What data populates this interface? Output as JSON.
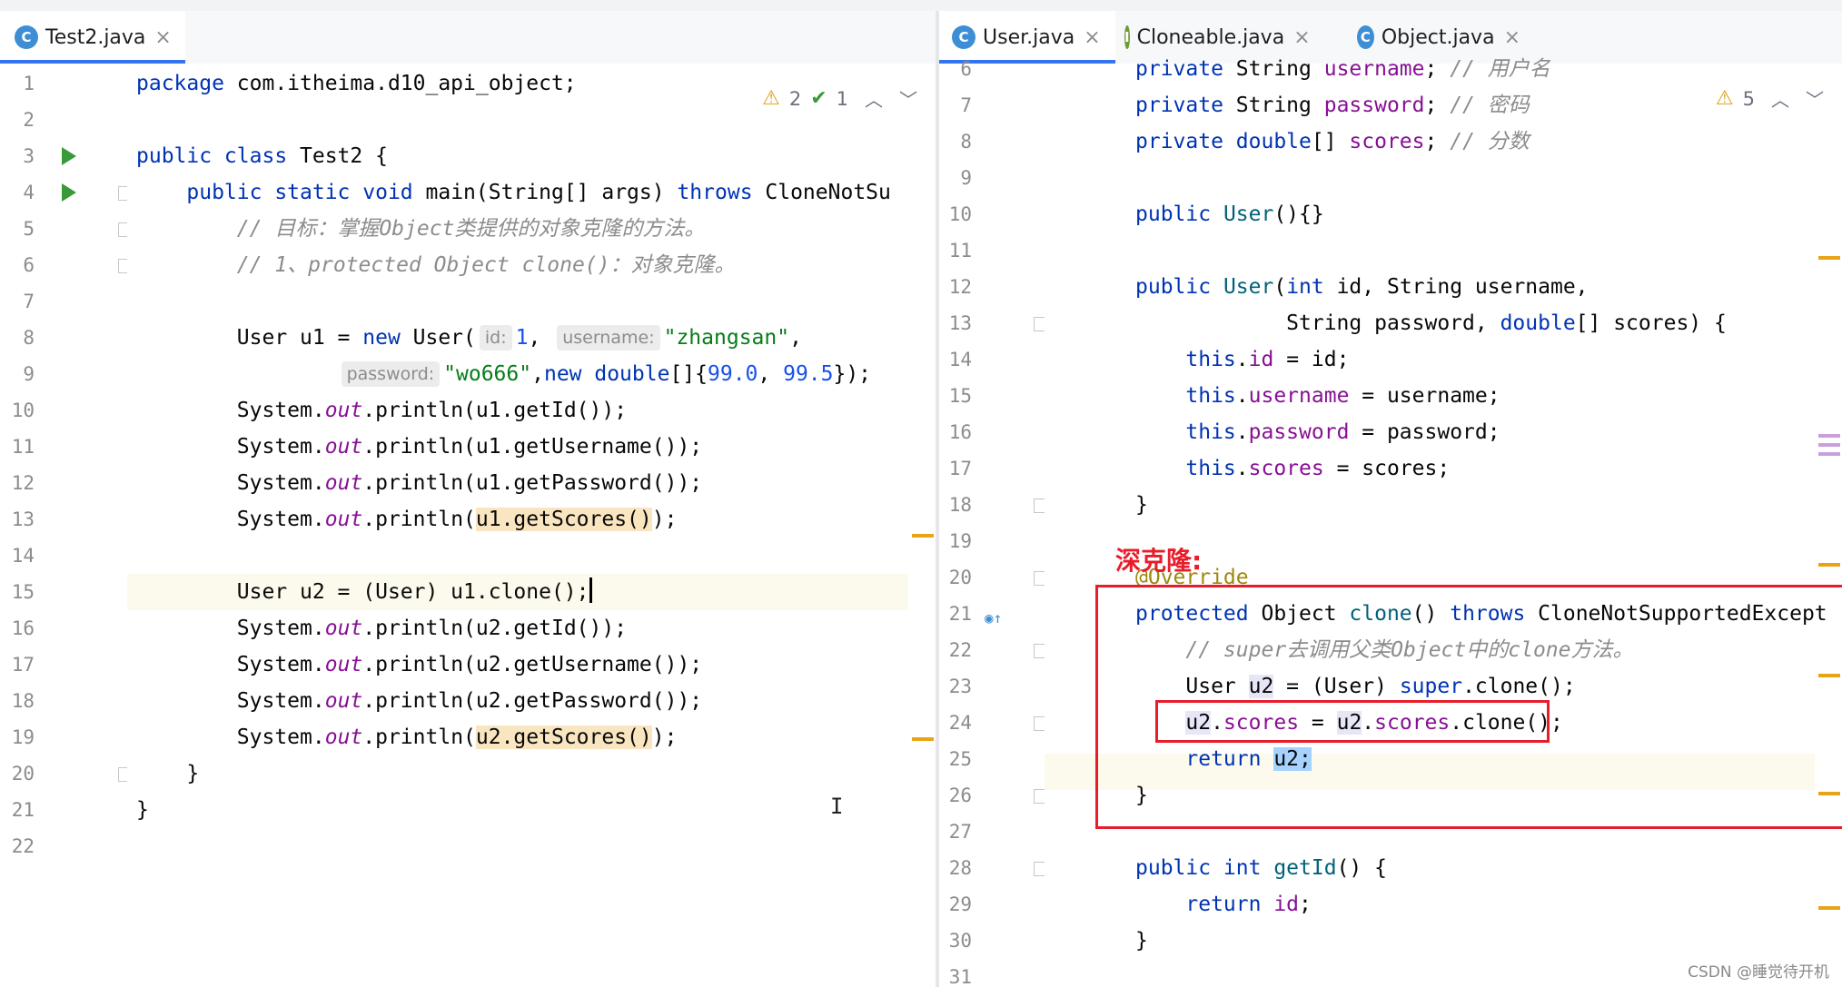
{
  "left": {
    "tabs": [
      {
        "label": "Test2.java",
        "icon": "c-class-icon"
      }
    ],
    "inspections": {
      "warnings": "2",
      "weak_warnings": "1"
    },
    "lines": [
      {
        "num": "1",
        "parts": [
          {
            "t": "package ",
            "c": "kw"
          },
          {
            "t": "com.itheima.d10_api_object;"
          }
        ]
      },
      {
        "num": "2",
        "parts": []
      },
      {
        "num": "3",
        "parts": [
          {
            "t": "public class ",
            "c": "kw"
          },
          {
            "t": "Test2 {"
          }
        ]
      },
      {
        "num": "4",
        "parts": [
          {
            "t": "    "
          },
          {
            "t": "public static void ",
            "c": "kw"
          },
          {
            "t": "main(String[] args) "
          },
          {
            "t": "throws ",
            "c": "kw"
          },
          {
            "t": "CloneNotSu"
          }
        ]
      },
      {
        "num": "5",
        "parts": [
          {
            "t": "        "
          },
          {
            "t": "// 目标：掌握Object类提供的对象克隆的方法。",
            "c": "cmt"
          }
        ]
      },
      {
        "num": "6",
        "parts": [
          {
            "t": "        "
          },
          {
            "t": "// 1、protected Object clone()：对象克隆。",
            "c": "cmt"
          }
        ]
      },
      {
        "num": "7",
        "parts": []
      },
      {
        "num": "8",
        "parts": [
          {
            "t": "        User u1 = "
          },
          {
            "t": "new ",
            "c": "kw"
          },
          {
            "t": "User("
          },
          {
            "t": "id:",
            "c": "hint"
          },
          {
            "t": "1",
            "c": "num"
          },
          {
            "t": ", "
          },
          {
            "t": "username:",
            "c": "hint"
          },
          {
            "t": "\"zhangsan\"",
            "c": "str"
          },
          {
            "t": ","
          }
        ]
      },
      {
        "num": "9",
        "parts": [
          {
            "t": "                "
          },
          {
            "t": "password:",
            "c": "hint"
          },
          {
            "t": "\"wo666\"",
            "c": "str"
          },
          {
            "t": ","
          },
          {
            "t": "new ",
            "c": "kw"
          },
          {
            "t": "double",
            "c": "kw"
          },
          {
            "t": "[]{"
          },
          {
            "t": "99.0",
            "c": "num"
          },
          {
            "t": ", "
          },
          {
            "t": "99.5",
            "c": "num"
          },
          {
            "t": "});"
          }
        ]
      },
      {
        "num": "10",
        "parts": [
          {
            "t": "        System."
          },
          {
            "t": "out",
            "c": "st"
          },
          {
            "t": ".println(u1.getId());"
          }
        ]
      },
      {
        "num": "11",
        "parts": [
          {
            "t": "        System."
          },
          {
            "t": "out",
            "c": "st"
          },
          {
            "t": ".println(u1.getUsername());"
          }
        ]
      },
      {
        "num": "12",
        "parts": [
          {
            "t": "        System."
          },
          {
            "t": "out",
            "c": "st"
          },
          {
            "t": ".println(u1.getPassword());"
          }
        ]
      },
      {
        "num": "13",
        "parts": [
          {
            "t": "        System."
          },
          {
            "t": "out",
            "c": "st"
          },
          {
            "t": ".println("
          },
          {
            "t": "u1.getScores()",
            "c": "hl"
          },
          {
            "t": ");"
          }
        ]
      },
      {
        "num": "14",
        "parts": []
      },
      {
        "num": "15",
        "parts": [
          {
            "t": "        User u2 = (User) u1.clone();"
          },
          {
            "t": "",
            "c": "caret"
          }
        ]
      },
      {
        "num": "16",
        "parts": [
          {
            "t": "        System."
          },
          {
            "t": "out",
            "c": "st"
          },
          {
            "t": ".println(u2.getId());"
          }
        ]
      },
      {
        "num": "17",
        "parts": [
          {
            "t": "        System."
          },
          {
            "t": "out",
            "c": "st"
          },
          {
            "t": ".println(u2.getUsername());"
          }
        ]
      },
      {
        "num": "18",
        "parts": [
          {
            "t": "        System."
          },
          {
            "t": "out",
            "c": "st"
          },
          {
            "t": ".println(u2.getPassword());"
          }
        ]
      },
      {
        "num": "19",
        "parts": [
          {
            "t": "        System."
          },
          {
            "t": "out",
            "c": "st"
          },
          {
            "t": ".println("
          },
          {
            "t": "u2.getScores()",
            "c": "hl"
          },
          {
            "t": ");"
          }
        ]
      },
      {
        "num": "20",
        "parts": [
          {
            "t": "    }"
          }
        ]
      },
      {
        "num": "21",
        "parts": [
          {
            "t": "}"
          }
        ]
      },
      {
        "num": "22",
        "parts": []
      }
    ]
  },
  "right": {
    "tabs": [
      {
        "label": "User.java",
        "icon": "c-class-icon"
      },
      {
        "label": "Cloneable.java",
        "icon": "i-interface-icon"
      },
      {
        "label": "Object.java",
        "icon": "c-class-icon"
      }
    ],
    "inspections": {
      "warnings": "5"
    },
    "annotation_label": "深克隆:",
    "lines": [
      {
        "num": "6",
        "parts": [
          {
            "t": "private ",
            "c": "kw"
          },
          {
            "t": "String "
          },
          {
            "t": "username",
            "c": "fld"
          },
          {
            "t": "; "
          },
          {
            "t": "// 用户名",
            "c": "cmt"
          }
        ]
      },
      {
        "num": "7",
        "parts": [
          {
            "t": "private ",
            "c": "kw"
          },
          {
            "t": "String "
          },
          {
            "t": "password",
            "c": "fld"
          },
          {
            "t": "; "
          },
          {
            "t": "// 密码",
            "c": "cmt"
          }
        ]
      },
      {
        "num": "8",
        "parts": [
          {
            "t": "private ",
            "c": "kw"
          },
          {
            "t": "double",
            "c": "kw"
          },
          {
            "t": "[] "
          },
          {
            "t": "scores",
            "c": "fld"
          },
          {
            "t": "; "
          },
          {
            "t": "// 分数",
            "c": "cmt"
          }
        ]
      },
      {
        "num": "9",
        "parts": []
      },
      {
        "num": "10",
        "parts": [
          {
            "t": "public ",
            "c": "kw"
          },
          {
            "t": "User",
            "c": "fn"
          },
          {
            "t": "(){}"
          }
        ]
      },
      {
        "num": "11",
        "parts": []
      },
      {
        "num": "12",
        "parts": [
          {
            "t": "public ",
            "c": "kw"
          },
          {
            "t": "User",
            "c": "fn"
          },
          {
            "t": "("
          },
          {
            "t": "int ",
            "c": "kw"
          },
          {
            "t": "id, String username,"
          }
        ]
      },
      {
        "num": "13",
        "parts": [
          {
            "t": "            String password, "
          },
          {
            "t": "double",
            "c": "kw"
          },
          {
            "t": "[] scores) {"
          }
        ]
      },
      {
        "num": "14",
        "parts": [
          {
            "t": "    "
          },
          {
            "t": "this",
            "c": "kw"
          },
          {
            "t": "."
          },
          {
            "t": "id",
            "c": "fld"
          },
          {
            "t": " = id;"
          }
        ]
      },
      {
        "num": "15",
        "parts": [
          {
            "t": "    "
          },
          {
            "t": "this",
            "c": "kw"
          },
          {
            "t": "."
          },
          {
            "t": "username",
            "c": "fld"
          },
          {
            "t": " = username;"
          }
        ]
      },
      {
        "num": "16",
        "parts": [
          {
            "t": "    "
          },
          {
            "t": "this",
            "c": "kw"
          },
          {
            "t": "."
          },
          {
            "t": "password",
            "c": "fld"
          },
          {
            "t": " = password;"
          }
        ]
      },
      {
        "num": "17",
        "parts": [
          {
            "t": "    "
          },
          {
            "t": "this",
            "c": "kw"
          },
          {
            "t": "."
          },
          {
            "t": "scores",
            "c": "fld"
          },
          {
            "t": " = scores;"
          }
        ]
      },
      {
        "num": "18",
        "parts": [
          {
            "t": "}"
          }
        ]
      },
      {
        "num": "19",
        "parts": []
      },
      {
        "num": "20",
        "parts": [
          {
            "t": "@Override",
            "c": "ann"
          }
        ]
      },
      {
        "num": "21",
        "parts": [
          {
            "t": "protected ",
            "c": "kw"
          },
          {
            "t": "Object "
          },
          {
            "t": "clone",
            "c": "fn"
          },
          {
            "t": "() "
          },
          {
            "t": "throws ",
            "c": "kw"
          },
          {
            "t": "CloneNotSupportedExcept"
          }
        ]
      },
      {
        "num": "22",
        "parts": [
          {
            "t": "    "
          },
          {
            "t": "// super去调用父类Object中的clone方法。",
            "c": "cmt"
          }
        ]
      },
      {
        "num": "23",
        "parts": [
          {
            "t": "    User "
          },
          {
            "t": "u2",
            "c": "hlr"
          },
          {
            "t": " = (User) "
          },
          {
            "t": "super",
            "c": "kw"
          },
          {
            "t": ".clone();"
          }
        ]
      },
      {
        "num": "24",
        "parts": [
          {
            "t": "    "
          },
          {
            "t": "u2",
            "c": "hlr"
          },
          {
            "t": "."
          },
          {
            "t": "scores",
            "c": "fld"
          },
          {
            "t": " = "
          },
          {
            "t": "u2",
            "c": "hlr"
          },
          {
            "t": "."
          },
          {
            "t": "scores",
            "c": "fld"
          },
          {
            "t": ".clone();"
          }
        ]
      },
      {
        "num": "25",
        "parts": [
          {
            "t": "    "
          },
          {
            "t": "return ",
            "c": "kw"
          },
          {
            "t": "u2;",
            "c": "sel"
          }
        ]
      },
      {
        "num": "26",
        "parts": [
          {
            "t": "}"
          }
        ]
      },
      {
        "num": "27",
        "parts": []
      },
      {
        "num": "28",
        "parts": [
          {
            "t": "public int ",
            "c": "kw"
          },
          {
            "t": "getId",
            "c": "fn"
          },
          {
            "t": "() {"
          }
        ]
      },
      {
        "num": "29",
        "parts": [
          {
            "t": "    "
          },
          {
            "t": "return ",
            "c": "kw"
          },
          {
            "t": "id",
            "c": "fld"
          },
          {
            "t": ";"
          }
        ]
      },
      {
        "num": "30",
        "parts": [
          {
            "t": "}"
          }
        ]
      },
      {
        "num": "31",
        "parts": []
      }
    ]
  },
  "watermark": "CSDN @睡觉待开机"
}
